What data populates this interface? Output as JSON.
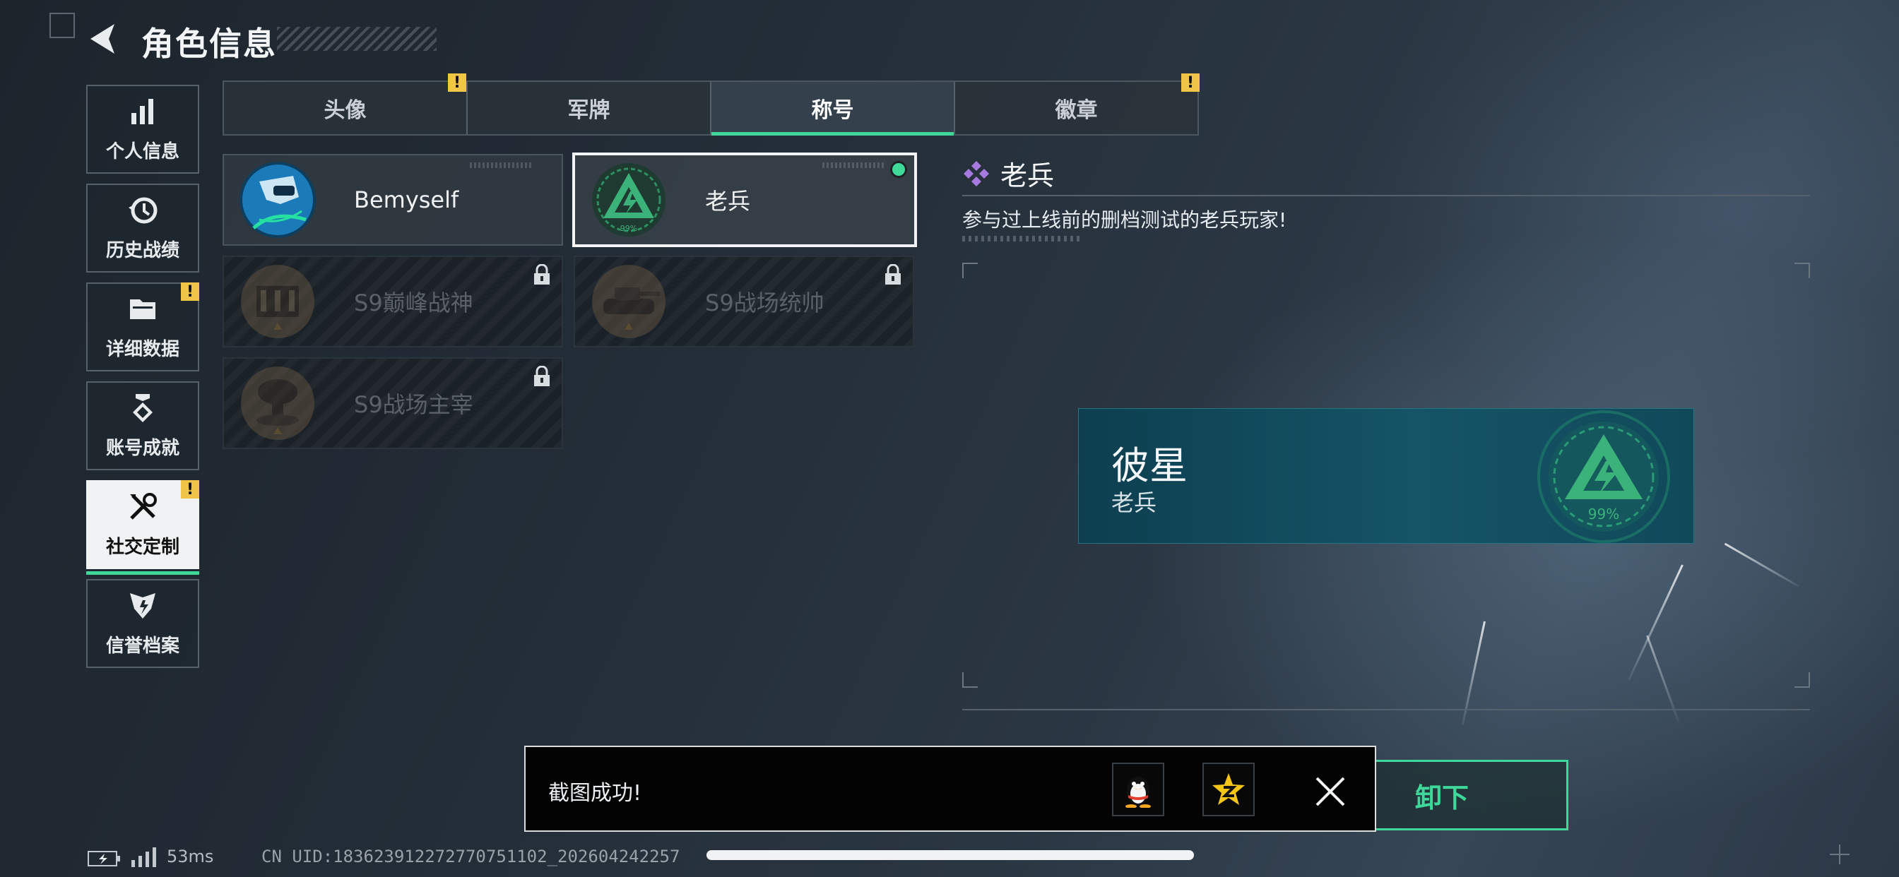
{
  "header": {
    "title": "角色信息"
  },
  "sidebar": {
    "items": [
      {
        "label": "个人信息",
        "icon": "bar-chart-icon",
        "warning": false,
        "active": false
      },
      {
        "label": "历史战绩",
        "icon": "history-clock-icon",
        "warning": false,
        "active": false
      },
      {
        "label": "详细数据",
        "icon": "folder-icon",
        "warning": true,
        "active": false
      },
      {
        "label": "账号成就",
        "icon": "medal-icon",
        "warning": false,
        "active": false
      },
      {
        "label": "社交定制",
        "icon": "tools-icon",
        "warning": true,
        "active": true
      },
      {
        "label": "信誉档案",
        "icon": "shield-icon",
        "warning": false,
        "active": false
      }
    ]
  },
  "tabs": [
    {
      "label": "头像",
      "warning": true,
      "active": false
    },
    {
      "label": "军牌",
      "warning": false,
      "active": false
    },
    {
      "label": "称号",
      "warning": false,
      "active": true
    },
    {
      "label": "徽章",
      "warning": true,
      "active": false
    }
  ],
  "titles": [
    {
      "name": "Bemyself",
      "emblem": "bemyself-avatar-emblem",
      "locked": false,
      "selected": false,
      "equipped": false
    },
    {
      "name": "老兵",
      "emblem": "veteran-triangle-emblem",
      "locked": false,
      "selected": true,
      "equipped": true
    },
    {
      "name": "S9巅峰战神",
      "emblem": "fortress-emblem",
      "locked": true,
      "selected": false,
      "equipped": false
    },
    {
      "name": "S9战场统帅",
      "emblem": "tank-emblem",
      "locked": true,
      "selected": false,
      "equipped": false
    },
    {
      "name": "S9战场主宰",
      "emblem": "mushroom-cloud-emblem",
      "locked": true,
      "selected": false,
      "equipped": false
    }
  ],
  "detail": {
    "title": "老兵",
    "description": "参与过上线前的删档测试的老兵玩家!",
    "title_icon": "purple-diamond-icon"
  },
  "nameplate": {
    "player_name": "彼星",
    "title": "老兵",
    "emblem_percent": "99%"
  },
  "equip_button": {
    "label": "卸下"
  },
  "toast": {
    "message": "截图成功!",
    "share_targets": [
      "qq-penguin-icon",
      "qzone-star-icon"
    ]
  },
  "footer": {
    "latency": "53ms",
    "uid": "CN UID:18362391227277075110​2_202604242257"
  },
  "colors": {
    "accent_green": "#3fd79a",
    "warning_yellow": "#f1c545",
    "nameplate_teal": "#145466",
    "diamond_purple": "#a77ae0"
  }
}
